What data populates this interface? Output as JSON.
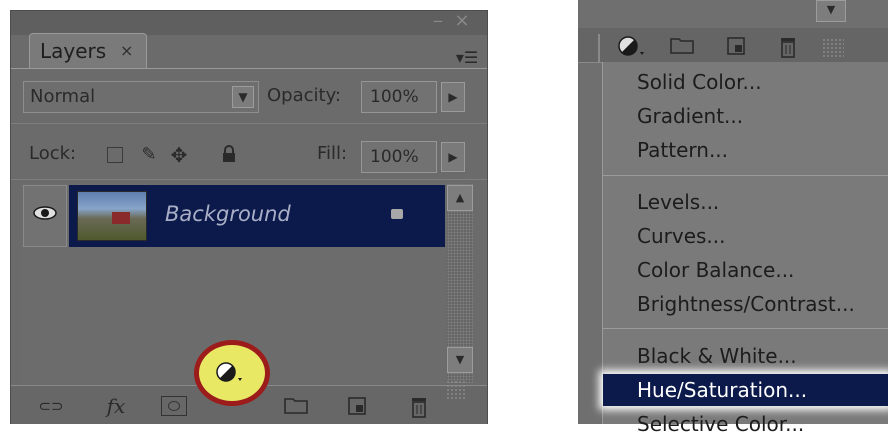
{
  "layers_panel": {
    "tab_label": "Layers",
    "tab_close": "×",
    "collapse_glyph": "‒",
    "close_glyph": "×",
    "menu_glyph": "▾☰",
    "blend_mode": "Normal",
    "opacity_label": "Opacity:",
    "opacity_value": "100%",
    "lock_label": "Lock:",
    "fill_label": "Fill:",
    "fill_value": "100%",
    "layers": [
      {
        "name": "Background",
        "visible": true,
        "locked": true,
        "selected": true
      }
    ],
    "bottom_icons": [
      "link-icon",
      "fx-icon",
      "mask-icon",
      "adjustment-layer-icon",
      "folder-icon",
      "new-layer-icon",
      "trash-icon"
    ],
    "fx_label": "fx",
    "highlighted_icon": "adjustment-layer-icon"
  },
  "adjustment_menu": {
    "items": [
      "Solid Color...",
      "Gradient...",
      "Pattern...",
      "Levels...",
      "Curves...",
      "Color Balance...",
      "Brightness/Contrast...",
      "Black & White...",
      "Hue/Saturation...",
      "Selective Color..."
    ],
    "highlighted_item": "Hue/Saturation..."
  },
  "colors": {
    "panel_gray": "#6b6b6b",
    "selection_navy": "#0c1a4b",
    "highlight_yellow": "#e8e865",
    "highlight_ring_red": "#9c1b1b"
  }
}
